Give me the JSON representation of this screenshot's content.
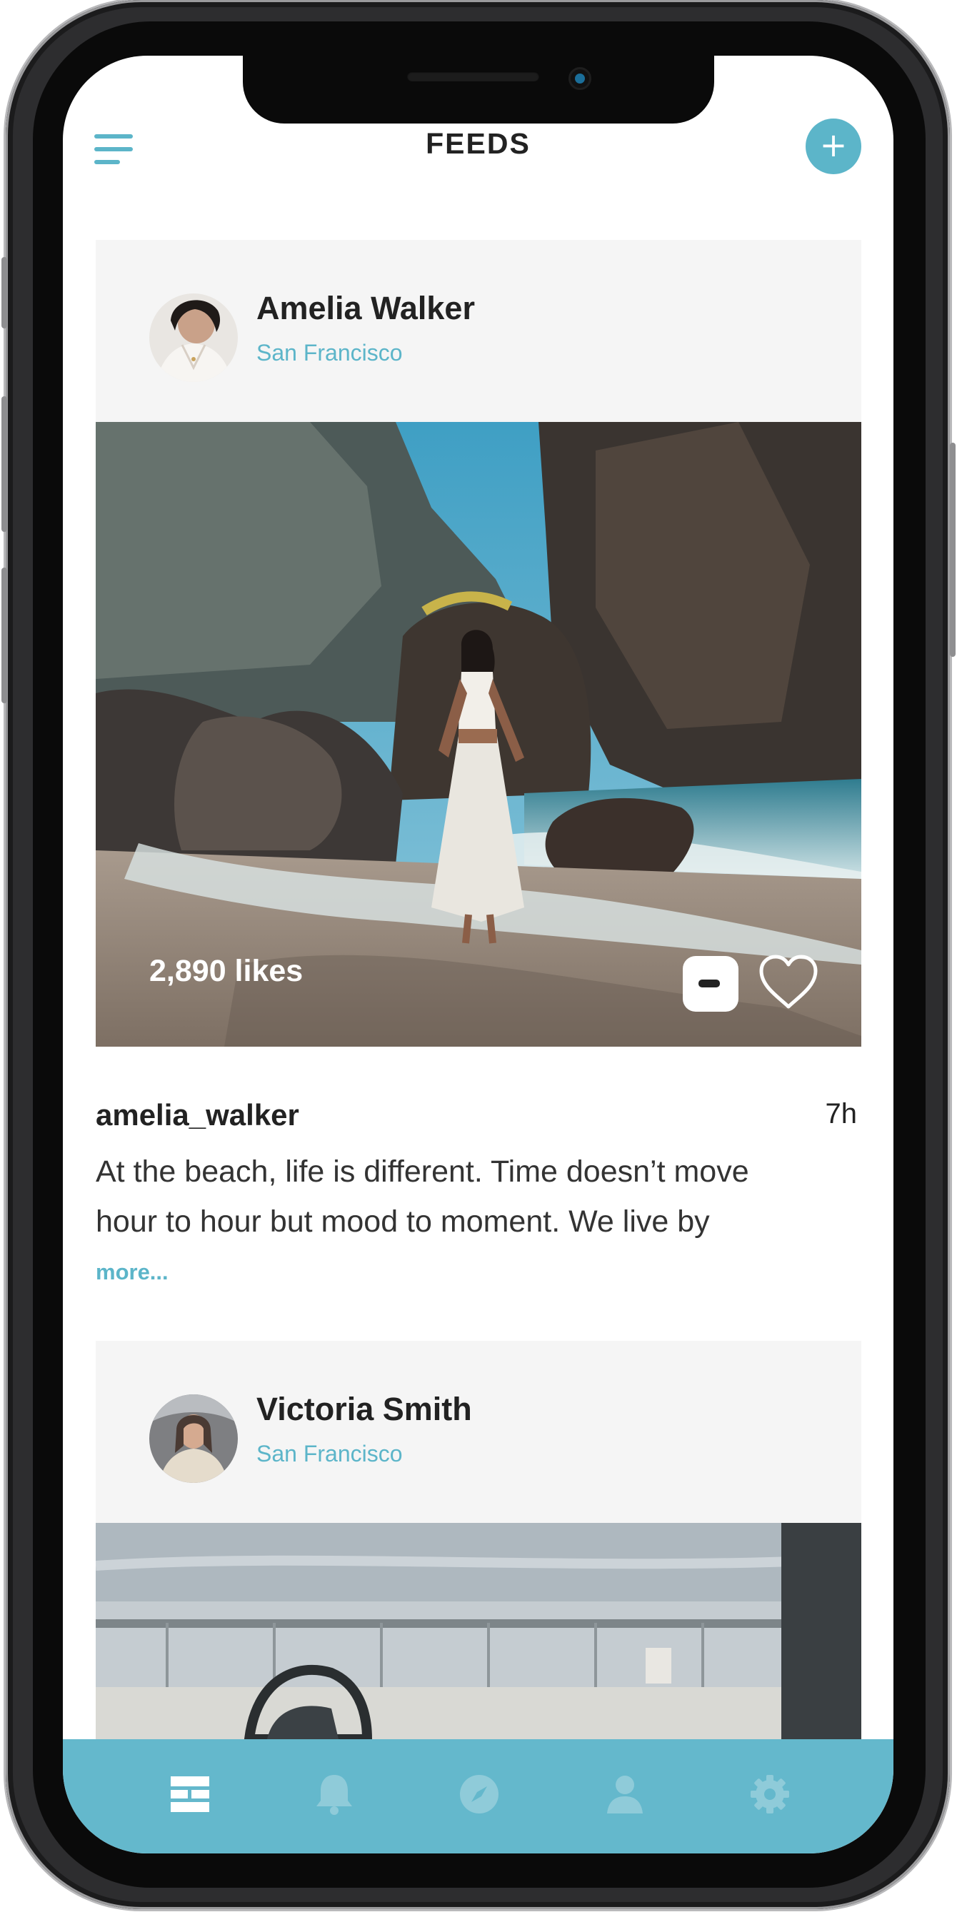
{
  "header": {
    "title": "FEEDS",
    "menu_icon": "hamburger-menu-icon",
    "add_icon": "plus-icon",
    "add_label": "+"
  },
  "posts": [
    {
      "author": "Amelia Walker",
      "location": "San Francisco",
      "likes": "2,890 likes",
      "username": "amelia_walker",
      "time": "7h",
      "caption_line1": "At the beach, life is different. Time doesn’t move",
      "caption_line2": "hour to hour but mood to moment. We live by",
      "more": "more...",
      "comment_icon": "comment-icon",
      "like_icon": "heart-icon"
    },
    {
      "author": "Victoria Smith",
      "location": "San Francisco"
    }
  ],
  "tab_bar": {
    "tabs": [
      {
        "icon": "feed-icon",
        "active": true
      },
      {
        "icon": "bell-icon",
        "active": false
      },
      {
        "icon": "compass-icon",
        "active": false
      },
      {
        "icon": "user-icon",
        "active": false
      },
      {
        "icon": "gear-icon",
        "active": false
      }
    ]
  },
  "colors": {
    "accent": "#5cb5c9",
    "tab_bar": "#64b8cc",
    "card_bg": "#f5f5f5",
    "text": "#222222"
  }
}
